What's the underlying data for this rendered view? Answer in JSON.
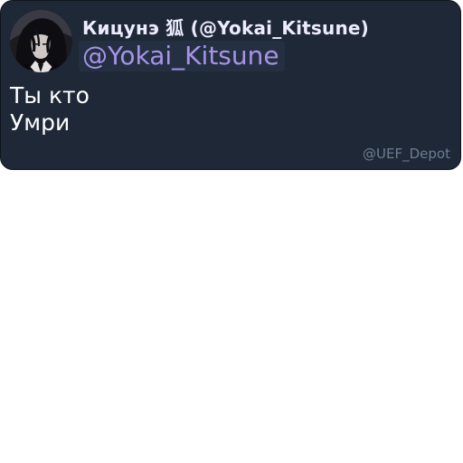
{
  "card": {
    "display_name": "Кицунэ 狐 (@Yokai_Kitsune)",
    "mention": "@Yokai_Kitsune",
    "message_lines": [
      "Ты кто",
      "Умри"
    ],
    "watermark": "@UEF_Depot"
  },
  "colors": {
    "card_background": "#1e2836",
    "display_name": "#ecebff",
    "mention_text": "#a893e8",
    "mention_background": "#243042",
    "message_text": "#ffffff",
    "watermark": "#6e7d92"
  },
  "icons": {
    "avatar": "dark-haired-anime-character-avatar"
  }
}
